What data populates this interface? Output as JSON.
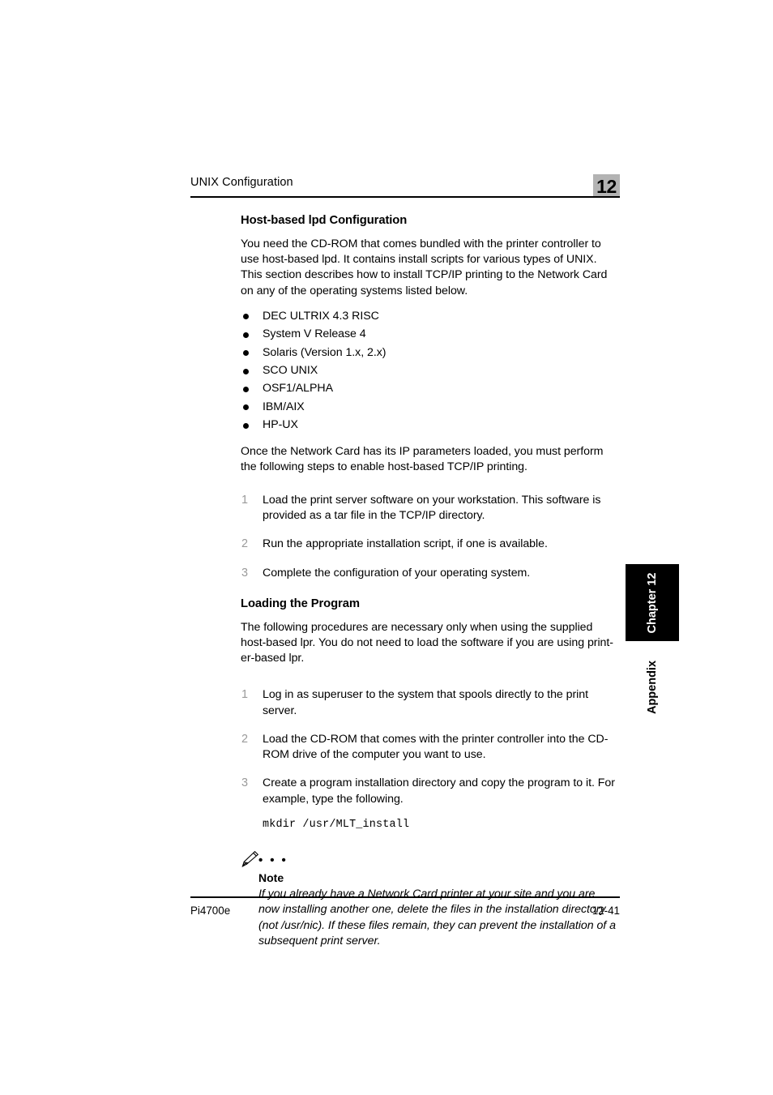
{
  "header": {
    "running_title": "UNIX Configuration",
    "chapter_number": "12",
    "chapter_box_color": "#b3b3b3"
  },
  "section1": {
    "heading": "Host-based lpd Configuration",
    "intro": "You need the CD-ROM that comes bundled with the printer controller to use host-based lpd. It contains install scripts for various types of UNIX. This section describes how to install TCP/IP printing to the Network Card on any of the operating systems listed below.",
    "os_list": [
      "DEC ULTRIX 4.3 RISC",
      "System V Release 4",
      "Solaris (Version 1.x, 2.x)",
      "SCO UNIX",
      "OSF1/ALPHA",
      "IBM/AIX",
      "HP-UX"
    ],
    "after_list": "Once the Network Card has its IP parameters loaded, you must perform the following steps to enable host-based TCP/IP printing.",
    "steps": [
      {
        "number": "1",
        "text": "Load the print server software on your workstation. This software is provided as a tar file in the TCP/IP directory."
      },
      {
        "number": "2",
        "text": "Run the appropriate installation script, if one is available."
      },
      {
        "number": "3",
        "text": "Complete the configuration of your operating system."
      }
    ]
  },
  "section2": {
    "heading": "Loading the Program",
    "intro": "The following procedures are necessary only when using the supplied host-based lpr. You do not need to load the software if you are using print-er-based lpr.",
    "steps": [
      {
        "number": "1",
        "text": "Log in as superuser to the system that spools directly to the print server."
      },
      {
        "number": "2",
        "text": "Load the CD-ROM that comes with the printer controller into the CD-ROM drive of the computer you want to use."
      },
      {
        "number": "3",
        "text": "Create a program installation directory and copy the program to it. For example, type the following."
      }
    ],
    "command": "mkdir /usr/MLT_install"
  },
  "note": {
    "icon": "pencil-icon",
    "dots": "• • •",
    "label": "Note",
    "text": "If you already have a Network Card printer at your site and you are now installing another one, delete the files in the installation directory (not /usr/nic). If these files remain, they can prevent the installation of a subsequent print server."
  },
  "side_tabs": [
    {
      "label": "Chapter 12",
      "style": "inverted"
    },
    {
      "label": "Appendix",
      "style": "plain"
    }
  ],
  "footer": {
    "left": "Pi4700e",
    "right": "12-41"
  }
}
